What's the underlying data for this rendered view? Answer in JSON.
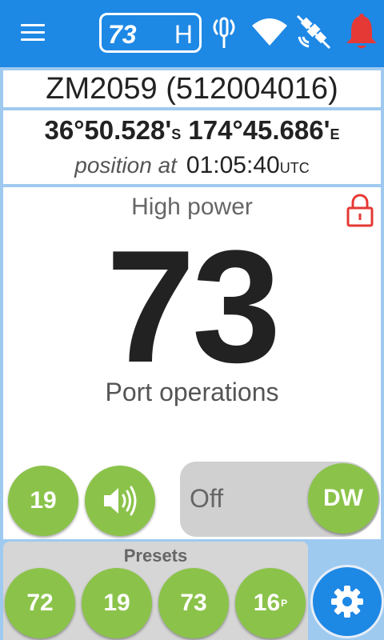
{
  "topbar": {
    "channel": "73",
    "power": "H",
    "icons": [
      "menu-icon",
      "antenna-icon",
      "wifi-icon",
      "satellite-off-icon",
      "alarm-bell-icon"
    ],
    "colors": {
      "bar": "#1e88e5",
      "alarm": "#e53935"
    }
  },
  "vessel": {
    "name": "ZM2059 (512004016)"
  },
  "position": {
    "lat": "36°50.528'",
    "lat_hemi": "S",
    "lon": "174°45.686'",
    "lon_hemi": "E",
    "label": "position at",
    "time": "01:05:40",
    "timezone": "UTC"
  },
  "main": {
    "power_label": "High power",
    "channel": "73",
    "channel_name": "Port operations",
    "lock_icon": "lock-icon",
    "lock_color": "#e53935"
  },
  "controls": {
    "dual_watch_channel": "19",
    "volume_icon": "volume-icon",
    "watch_mode": "Off",
    "watch_button": "DW",
    "button_color": "#8bc34a"
  },
  "presets": {
    "title": "Presets",
    "items": [
      {
        "label": "72",
        "suffix": ""
      },
      {
        "label": "19",
        "suffix": ""
      },
      {
        "label": "73",
        "suffix": ""
      },
      {
        "label": "16",
        "suffix": "P"
      }
    ]
  },
  "settings": {
    "icon": "gear-icon"
  }
}
